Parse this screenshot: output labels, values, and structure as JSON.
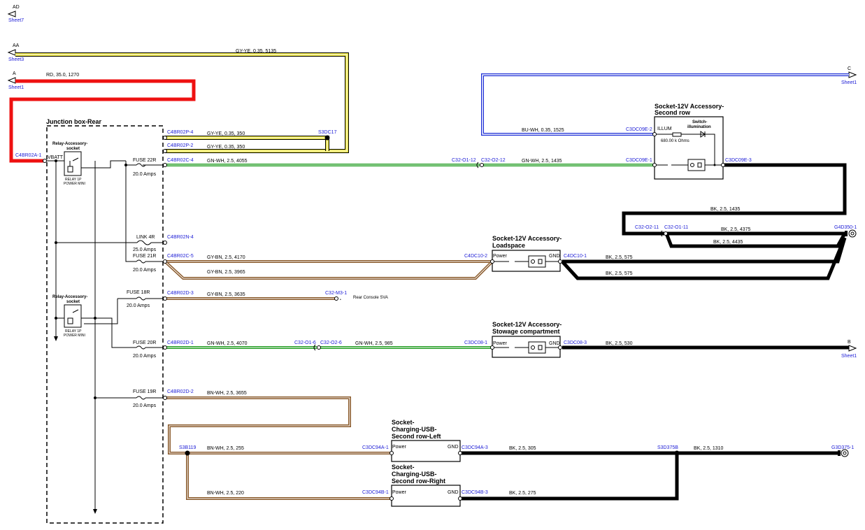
{
  "colors": {
    "red": "#ee1111",
    "yellow": "#e8e23c",
    "blue": "#1c2ed6",
    "green": "#2aa02a",
    "brown": "#8a5a2b",
    "black": "#000000",
    "link_blue": "#1c1cd6"
  },
  "offsheet": {
    "ad": {
      "letter": "AD",
      "sheet": "Sheet7"
    },
    "aa": {
      "letter": "AA",
      "sheet": "Sheet3"
    },
    "a": {
      "letter": "A",
      "sheet": "Sheet1"
    },
    "c": {
      "letter": "C",
      "sheet": "Sheet1"
    },
    "b": {
      "letter": "B",
      "sheet": "Sheet1"
    }
  },
  "wires": {
    "gy_ye_5135": "GY-YE,  0.35,  5135",
    "rd_1270": "RD,  35.0,  1270",
    "bu_wh_1525": "BU-WH,  0.35,  1525",
    "gy_ye_350a": "GY-YE,  0.35,  350",
    "gy_ye_350b": "GY-YE,  0.35,  350",
    "gn_wh_4055": "GN-WH,  2.5,  4055",
    "gn_wh_1435": "GN-WH,  2.5,  1435",
    "bk_1435": "BK,  2.5,  1435",
    "bk_4375": "BK,  2.5,  4375",
    "bk_4435": "BK,  2.5,  4435",
    "gy_bn_4170": "GY-BN,  2.5,  4170",
    "gy_bn_3965": "GY-BN,  2.5,  3965",
    "bk_575a": "BK,  2.5,  575",
    "bk_575b": "BK,  2.5,  575",
    "gy_bn_3635": "GY-BN,  2.5,  3635",
    "gn_wh_4070": "GN-WH,  2.5,  4070",
    "gn_wh_985": "GN-WH,  2.5,  985",
    "bk_530": "BK,  2.5,  530",
    "bn_wh_3655": "BN-WH,  2.5,  3655",
    "bn_wh_255": "BN-WH,  2.5,  255",
    "bk_305": "BK,  2.5,  305",
    "bk_1310": "BK,  2.5,  1310",
    "bn_wh_220": "BN-WH,  2.5,  220",
    "bk_275": "BK,  2.5,  275"
  },
  "connectors": {
    "c4br02a_1": "C4BR02A-1",
    "c4br02p_4": "C4BR02P-4",
    "c4br02p_2": "C4BR02P-2",
    "s3dc17": "S3DC17",
    "c4br02c_4": "C4BR02C-4",
    "c32_o1_12": "C32-O1-12",
    "c32_o2_12": "C32-O2-12",
    "c3dc09e_2": "C3DC09E-2",
    "c3dc09e_1": "C3DC09E-1",
    "c3dc09e_3": "C3DC09E-3",
    "c32_o2_11": "C32-O2-11",
    "c32_o1_11": "C32-O1-11",
    "g4d350_1": "G4D350-1",
    "c4br02n_4": "C4BR02N-4",
    "c4br02c_5": "C4BR02C-5",
    "c4dc10_2": "C4DC10-2",
    "c4dc10_1": "C4DC10-1",
    "c4br02d_3": "C4BR02D-3",
    "c32_m3_1": "C32-M3-1",
    "c4br02d_1": "C4BR02D-1",
    "c32_o1_6": "C32-O1-6",
    "c32_o2_6": "C32-O2-6",
    "c3dc08_1": "C3DC08-1",
    "c3dc08_3": "C3DC08-3",
    "c4br02d_2": "C4BR02D-2",
    "s3b119": "S3B119",
    "c3dc94a_1": "C3DC94A-1",
    "c3dc94a_3": "C3DC94A-3",
    "s3d375b": "S3D375B",
    "g3d375_1": "G3D375-1",
    "c3dc94b_1": "C3DC94B-1",
    "c3dc94b_3": "C3DC94B-3"
  },
  "junction_box": {
    "title": "Junction box-Rear",
    "vbatt": "VBATT",
    "relay_top": {
      "title1": "Relay-Accessory-",
      "title2": "socket",
      "sub1": "RELAY 1P",
      "sub2": "POWER MINI"
    },
    "relay_bottom": {
      "title1": "Relay-Accessory-",
      "title2": "socket",
      "sub1": "RELAY 1P",
      "sub2": "POWER MINI"
    },
    "fuses": [
      {
        "name": "FUSE 22R",
        "rating": "20.0 Amps"
      },
      {
        "name": "LINK 4R",
        "rating": "25.0 Amps"
      },
      {
        "name": "FUSE 21R",
        "rating": "20.0 Amps"
      },
      {
        "name": "FUSE 18R",
        "rating": "20.0 Amps"
      },
      {
        "name": "FUSE 20R",
        "rating": "20.0 Amps"
      },
      {
        "name": "FUSE 19R",
        "rating": "20.0 Amps"
      }
    ]
  },
  "components": {
    "second_row": {
      "title1": "Socket-12V Accessory-",
      "title2": "Second row",
      "illum": "ILLUM",
      "resistor": "680.00 k Ohms",
      "switch1": "Switch-",
      "switch2": "illumination"
    },
    "loadspace": {
      "title1": "Socket-12V Accessory-",
      "title2": "Loadspace",
      "power": "Power",
      "gnd": "GND"
    },
    "stowage": {
      "title1": "Socket-12V Accessory-",
      "title2": "Stowage compartment",
      "power": "Power",
      "gnd": "GND"
    },
    "usb_left": {
      "title1": "Socket-",
      "title2": "Charging-USB-",
      "title3": "Second row-Left",
      "power": "Power",
      "gnd": "GND"
    },
    "usb_right": {
      "title1": "Socket-",
      "title2": "Charging-USB-",
      "title3": "Second row-Right",
      "power": "Power",
      "gnd": "GND"
    },
    "rear_console": "Rear Console SVA"
  }
}
